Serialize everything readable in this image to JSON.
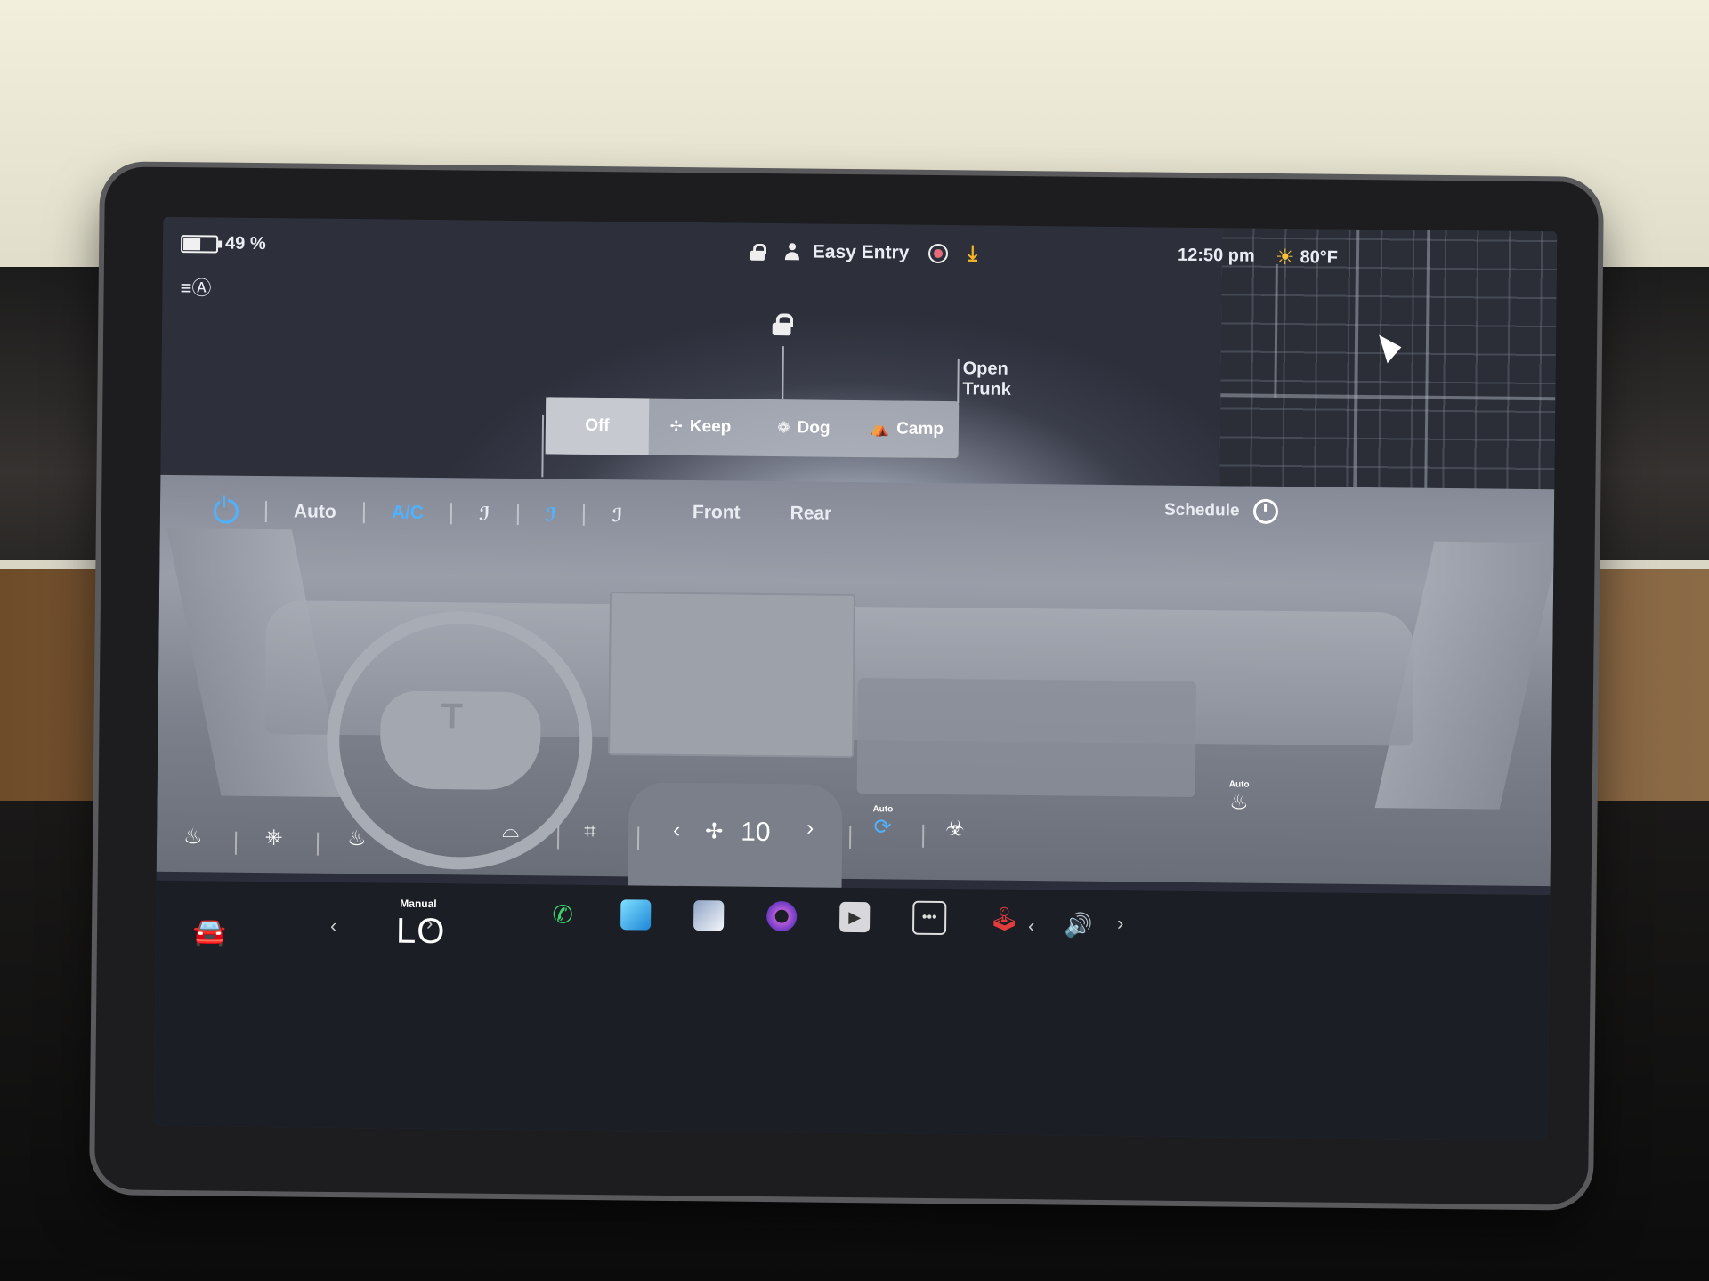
{
  "status": {
    "battery_percent": "49 %",
    "battery_level": 0.49,
    "profile_name": "Easy Entry",
    "time": "12:50 pm",
    "temperature": "80°F"
  },
  "car_view": {
    "open_trunk": "Open\nTrunk",
    "climate_modes": [
      {
        "label": "Off",
        "icon": "none",
        "active": true
      },
      {
        "label": "Keep",
        "icon": "fan-icon",
        "active": false
      },
      {
        "label": "Dog",
        "icon": "paw-icon",
        "active": false
      },
      {
        "label": "Camp",
        "icon": "tent-icon",
        "active": false
      }
    ]
  },
  "climate": {
    "auto_label": "Auto",
    "ac_label": "A/C",
    "front_label": "Front",
    "rear_label": "Rear",
    "schedule_label": "Schedule",
    "fan_speed": "10",
    "recirc_auto_label": "Auto",
    "seat_auto_label": "Auto",
    "accent_color": "#4fb2ff"
  },
  "taskbar": {
    "temp_mode": "Manual",
    "temp_value": "LO"
  },
  "colors": {
    "accent_blue": "#4fb2ff",
    "download_orange": "#f4b524",
    "record_pink": "#e66b7c",
    "phone_green": "#3ed06b"
  }
}
